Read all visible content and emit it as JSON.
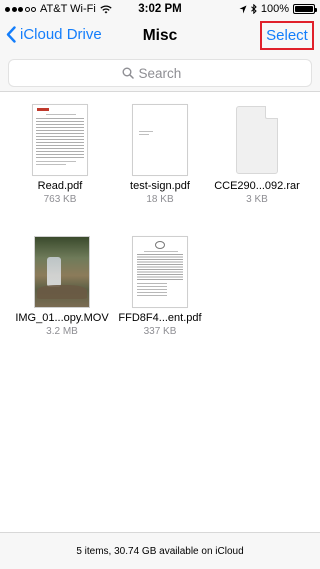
{
  "status_bar": {
    "carrier": "AT&T Wi-Fi",
    "time": "3:02 PM",
    "battery": "100%",
    "battery_level": 1.0,
    "signal_bars_filled": 3,
    "signal_bars_total": 5
  },
  "nav": {
    "back_label": "iCloud Drive",
    "title": "Misc",
    "select_label": "Select"
  },
  "search": {
    "placeholder": "Search",
    "value": ""
  },
  "files": [
    {
      "name": "Read.pdf",
      "size": "763 KB",
      "kind": "pdf"
    },
    {
      "name": "test-sign.pdf",
      "size": "18 KB",
      "kind": "pdf"
    },
    {
      "name": "CCE290...092.rar",
      "size": "3 KB",
      "kind": "rar"
    },
    {
      "name": "IMG_01...opy.MOV",
      "size": "3.2 MB",
      "kind": "video"
    },
    {
      "name": "FFD8F4...ent.pdf",
      "size": "337 KB",
      "kind": "pdf"
    }
  ],
  "footer": {
    "summary": "5 items, 30.74 GB available on iCloud"
  },
  "colors": {
    "accent": "#147efb",
    "highlight_border": "#e0202a",
    "secondary_text": "#8e8e93",
    "bar_background": "#f7f7f7"
  },
  "icons": {
    "back": "chevron-left-icon",
    "search": "magnifier-icon",
    "wifi": "wifi-icon",
    "location": "location-arrow-icon",
    "bluetooth": "bluetooth-icon",
    "battery": "battery-icon"
  }
}
